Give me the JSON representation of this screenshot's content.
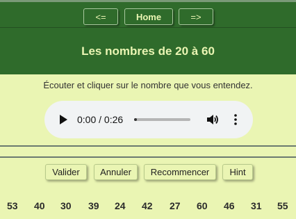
{
  "nav": {
    "prev_label": "<=",
    "home_label": "Home",
    "next_label": "=>"
  },
  "header": {
    "title": "Les nombres de 20 à 60"
  },
  "instructions": "Écouter et cliquer sur le nombre que vous entendez.",
  "audio": {
    "time": "0:00 / 0:26",
    "progress": 0.0,
    "icons": [
      "play-icon",
      "volume-icon",
      "more-options-icon"
    ]
  },
  "actions": {
    "valider": "Valider",
    "annuler": "Annuler",
    "recommencer": "Recommencer",
    "hint": "Hint"
  },
  "numbers": [
    "53",
    "40",
    "30",
    "39",
    "24",
    "42",
    "27",
    "60",
    "46",
    "31",
    "55"
  ],
  "colors": {
    "background": "#eaf5b3",
    "header": "#2f6b2b",
    "header_text": "#eaf5b3"
  }
}
